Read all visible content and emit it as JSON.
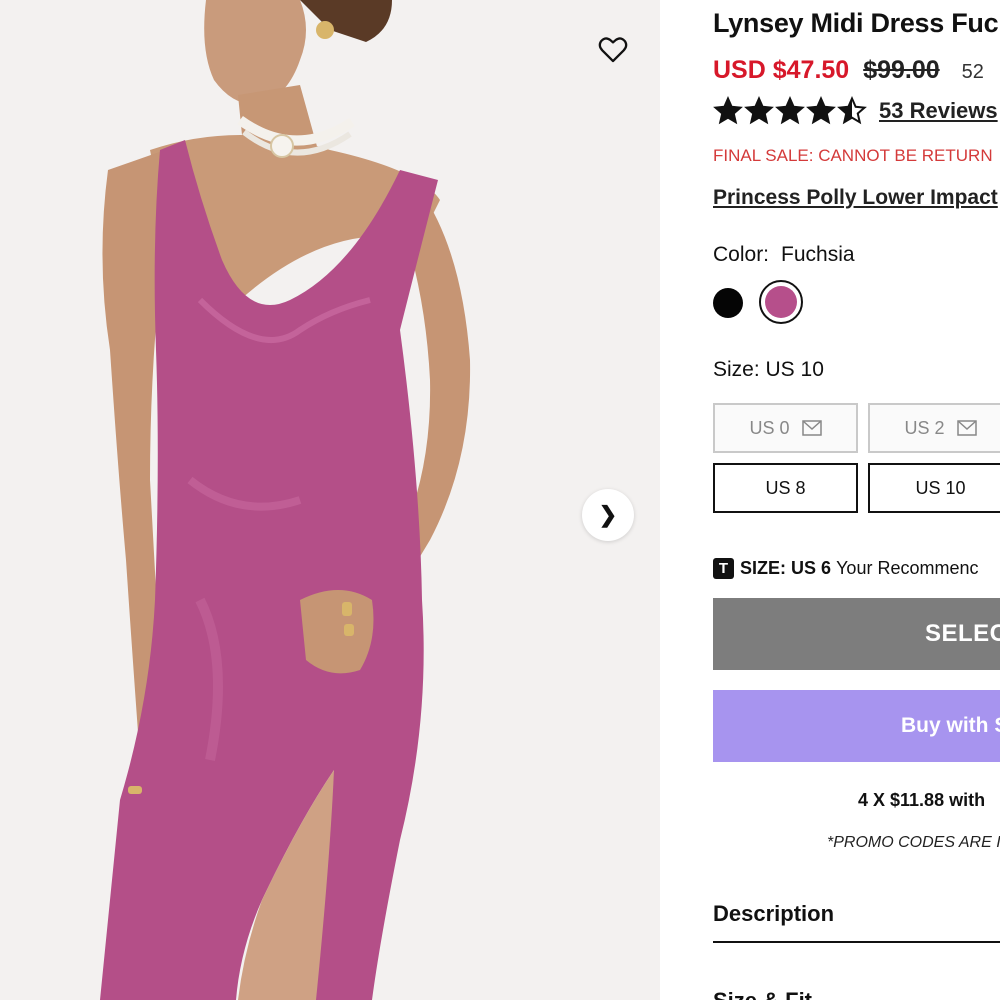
{
  "product": {
    "title": "Lynsey Midi Dress Fuc",
    "price_now": "USD $47.50",
    "price_was": "$99.00",
    "discount_fragment": "52",
    "rating_value": 4.5,
    "reviews_label": "53 Reviews",
    "final_sale": "FINAL SALE: CANNOT BE RETURN",
    "promo_link": "Princess Polly Lower Impact"
  },
  "color": {
    "label": "Color:",
    "value": "Fuchsia",
    "swatches": [
      {
        "name": "Black",
        "hex": "#050505",
        "selected": false
      },
      {
        "name": "Fuchsia",
        "hex": "#b64f8b",
        "selected": true
      }
    ]
  },
  "size": {
    "label": "Size: US 10",
    "options": [
      {
        "label": "US 0",
        "available": false
      },
      {
        "label": "US 2",
        "available": false
      },
      {
        "label": "US 8",
        "available": true
      },
      {
        "label": "US 10",
        "available": true,
        "selected": true
      }
    ]
  },
  "recommendation": {
    "badge": "T",
    "size_label": "SIZE:",
    "size_value": "US 6",
    "text": "Your Recommenc"
  },
  "actions": {
    "select_label": "SELEC",
    "buy_label": "Buy with",
    "buy_brand_fragment": "S"
  },
  "installments": "4 X $11.88 with",
  "promo_note": "*PROMO CODES ARE I",
  "sections": {
    "description": "Description",
    "size_fit": "Size & Fit"
  },
  "gallery": {
    "next_arrow": "❯",
    "wishlist_icon": "heart-outline-icon"
  },
  "colors": {
    "sale_red": "#d7182a",
    "select_gray": "#7d7d7d",
    "buy_purple": "#a794ef",
    "dress": "#b64f8b"
  }
}
